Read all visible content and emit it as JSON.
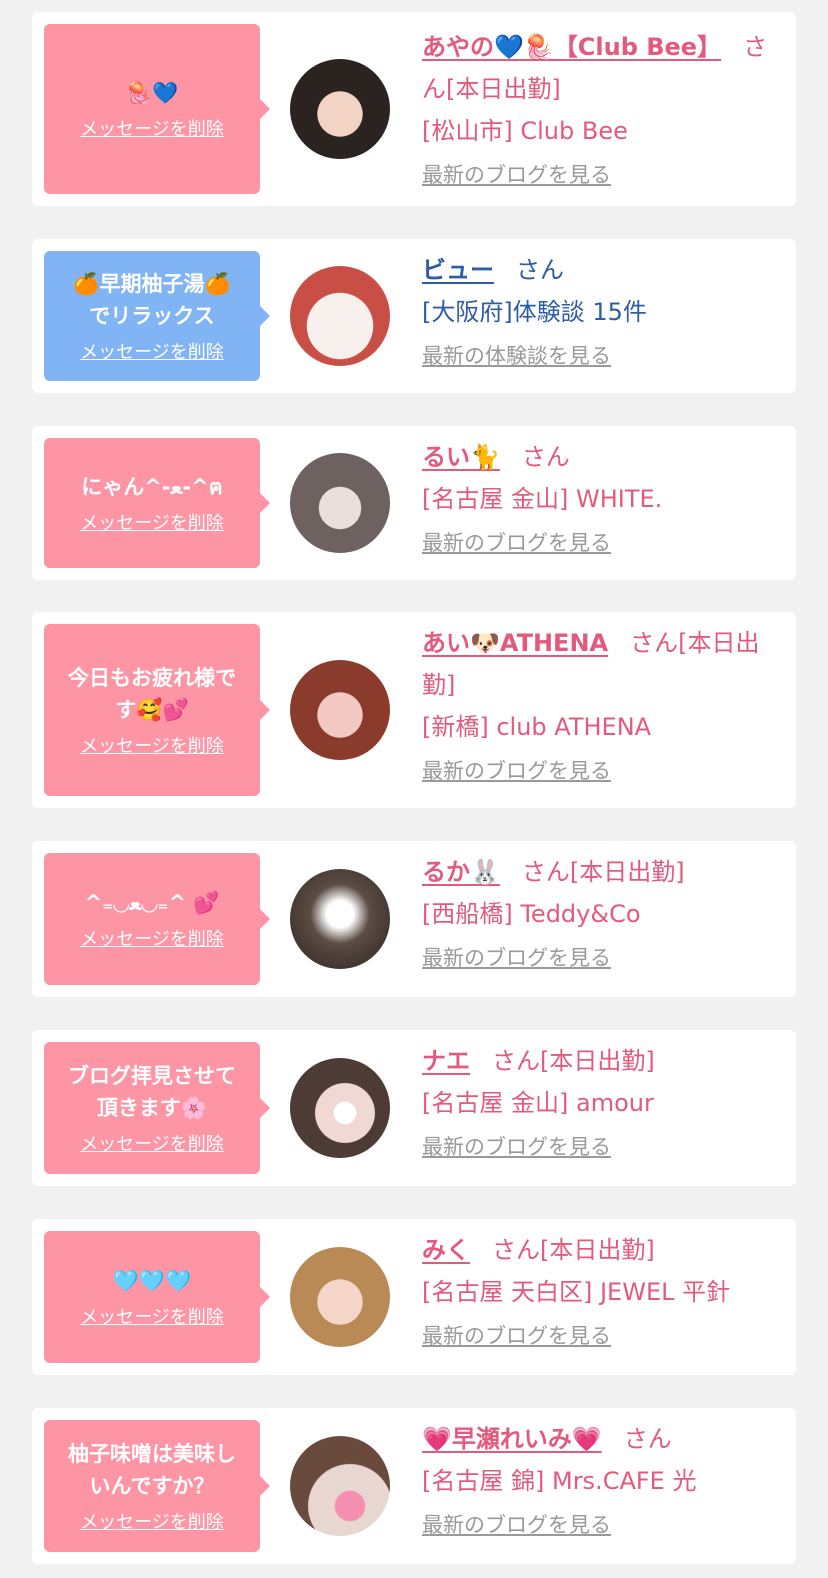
{
  "delete_label": "メッセージを削除",
  "san_suffix": "さん",
  "colors": {
    "bubble_pink": "#fd95a5",
    "bubble_blue": "#80b4f4",
    "name_pink": "#e35a7d",
    "name_blue": "#2d5da4",
    "link_gray": "#999999"
  },
  "messages": [
    {
      "bubble_text": "🪼💙",
      "name": "あやの💙🪼【Club Bee】",
      "status": "さん[本日出勤]",
      "shop": "[松山市] Club Bee",
      "more": "最新のブログを見る"
    },
    {
      "bubble_text": "🍊早期柚子湯🍊\nでリラックス",
      "name": "ビュー",
      "status": "さん",
      "shop": "[大阪府]体験談 15件",
      "more": "最新の体験談を見る"
    },
    {
      "bubble_text": "にゃん^-ﻌ-^ฅ",
      "name": "るい🐈",
      "status": "さん",
      "shop": "[名古屋 金山] WHITE.",
      "more": "最新のブログを見る"
    },
    {
      "bubble_text": "今日もお疲れ様で\nす🥰💕",
      "name": "あい🐶ATHENA",
      "status": "さん[本日出勤]",
      "shop": "[新橋] club ATHENA",
      "more": "最新のブログを見る"
    },
    {
      "bubble_text": "^₌◡ﻌ◡₌^ 💕",
      "name": "るか🐰",
      "status": "さん[本日出勤]",
      "shop": "[西船橋] Teddy&Co",
      "more": "最新のブログを見る"
    },
    {
      "bubble_text": "ブログ拝見させて\n頂きます🌸",
      "name": "ナエ",
      "status": "さん[本日出勤]",
      "shop": "[名古屋 金山] amour",
      "more": "最新のブログを見る"
    },
    {
      "bubble_text": "🩵🩵🩵",
      "name": "みく",
      "status": "さん[本日出勤]",
      "shop": "[名古屋 天白区] JEWEL 平針",
      "more": "最新のブログを見る"
    },
    {
      "bubble_text": "柚子味噌は美味し\nいんですか？",
      "name": "💗早瀬れいみ💗",
      "status": "さん",
      "shop": "[名古屋 錦] Mrs.CAFE 光",
      "more": "最新のブログを見る"
    }
  ]
}
